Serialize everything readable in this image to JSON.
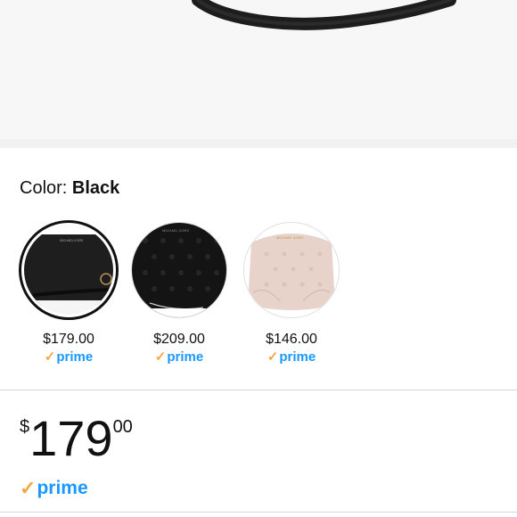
{
  "color": {
    "label": "Color: ",
    "value": "Black"
  },
  "swatches": [
    {
      "price": "$179.00",
      "prime": "prime",
      "selected": true,
      "tone": "#1b1b1b",
      "brand": "MICHAEL KORS"
    },
    {
      "price": "$209.00",
      "prime": "prime",
      "selected": false,
      "tone": "#151515",
      "brand": "MICHAEL KORS"
    },
    {
      "price": "$146.00",
      "prime": "prime",
      "selected": false,
      "tone": "#e9d5cc",
      "brand": "MICHAEL KORS"
    }
  ],
  "price": {
    "currency": "$",
    "whole": "179",
    "fraction": "00"
  },
  "prime": {
    "label": "prime"
  },
  "colors": {
    "prime_blue": "#1a98ff",
    "prime_check": "#f3a847",
    "divider": "#d5d5d5"
  },
  "icons": {
    "prime_check": "check-icon"
  }
}
